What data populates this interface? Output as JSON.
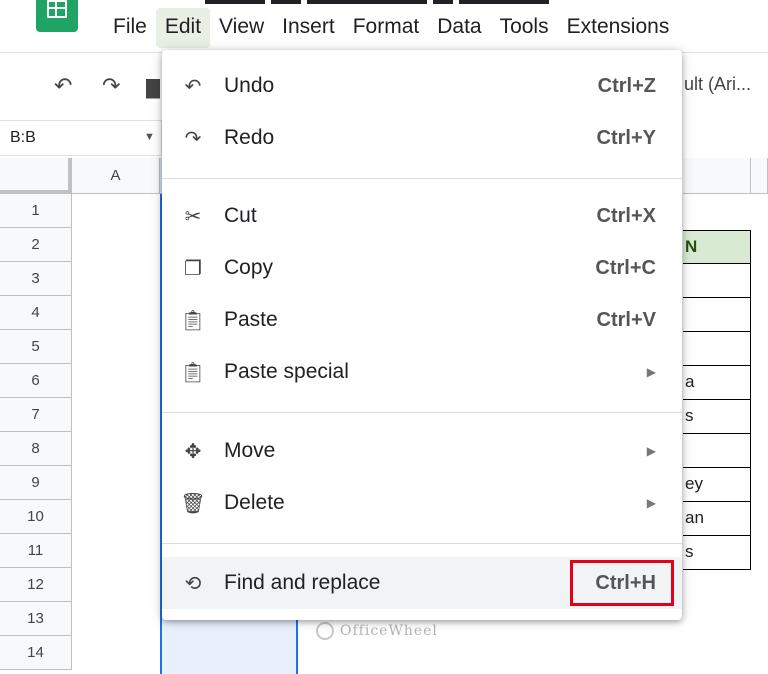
{
  "menubar": {
    "items": [
      {
        "label": "File"
      },
      {
        "label": "Edit",
        "active": true
      },
      {
        "label": "View"
      },
      {
        "label": "Insert"
      },
      {
        "label": "Format"
      },
      {
        "label": "Data"
      },
      {
        "label": "Tools"
      },
      {
        "label": "Extensions"
      }
    ]
  },
  "toolbar": {
    "font_label": "ult (Ari..."
  },
  "name_box": {
    "value": "B:B"
  },
  "grid": {
    "columns": [
      "A"
    ],
    "rows": [
      "1",
      "2",
      "3",
      "4",
      "5",
      "6",
      "7",
      "8",
      "9",
      "10",
      "11",
      "12",
      "13",
      "14"
    ],
    "visible_table": {
      "header": "N",
      "cells": [
        "",
        "",
        "",
        "a",
        "s",
        "",
        "ey",
        "an",
        "s"
      ]
    }
  },
  "edit_menu": {
    "items": [
      {
        "label": "Undo",
        "shortcut": "Ctrl+Z",
        "icon": "undo-icon"
      },
      {
        "label": "Redo",
        "shortcut": "Ctrl+Y",
        "icon": "redo-icon"
      },
      {
        "label": "Cut",
        "shortcut": "Ctrl+X",
        "icon": "scissors-icon"
      },
      {
        "label": "Copy",
        "shortcut": "Ctrl+C",
        "icon": "copy-icon"
      },
      {
        "label": "Paste",
        "shortcut": "Ctrl+V",
        "icon": "clipboard-icon"
      },
      {
        "label": "Paste special",
        "shortcut": "",
        "icon": "clipboard-icon",
        "submenu": true
      },
      {
        "label": "Move",
        "shortcut": "",
        "icon": "move-icon",
        "submenu": true
      },
      {
        "label": "Delete",
        "shortcut": "",
        "icon": "trash-icon",
        "submenu": true
      },
      {
        "label": "Find and replace",
        "shortcut": "Ctrl+H",
        "icon": "find-replace-icon",
        "highlighted": true
      }
    ]
  },
  "watermark": {
    "text": "OfficeWheel"
  },
  "colors": {
    "accent": "#1a73e8",
    "logo": "#1fa463",
    "highlight_box": "#e4001b",
    "header_fill": "#d9ead3"
  }
}
